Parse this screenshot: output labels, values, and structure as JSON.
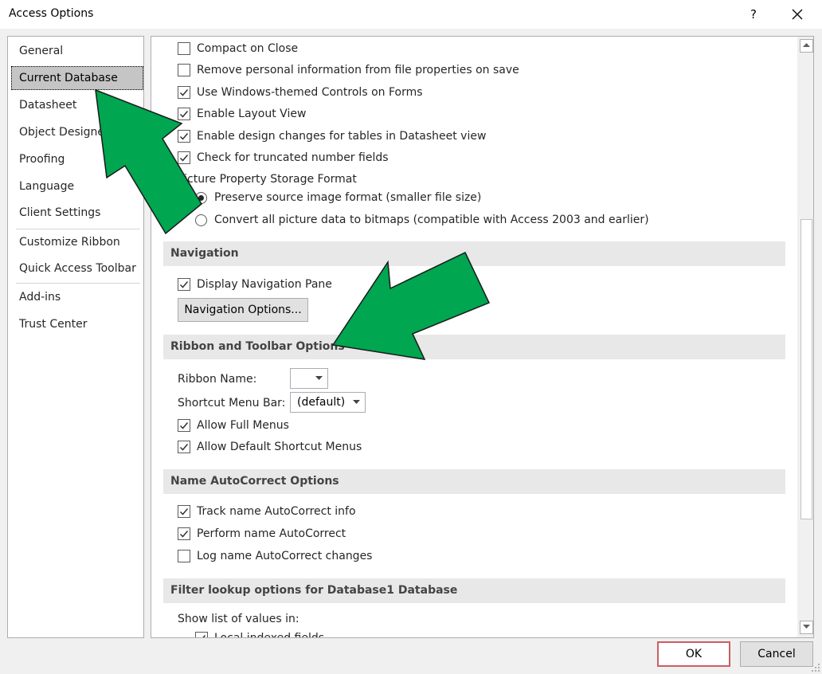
{
  "window": {
    "title": "Access Options",
    "help_label": "?"
  },
  "sidebar": {
    "items": [
      {
        "label": "General"
      },
      {
        "label": "Current Database"
      },
      {
        "label": "Datasheet"
      },
      {
        "label": "Object Designers"
      },
      {
        "label": "Proofing"
      },
      {
        "label": "Language"
      },
      {
        "label": "Client Settings"
      },
      {
        "label": "Customize Ribbon"
      },
      {
        "label": "Quick Access Toolbar"
      },
      {
        "label": "Add-ins"
      },
      {
        "label": "Trust Center"
      }
    ],
    "selected": "Current Database"
  },
  "application_options": {
    "compact_on_close": {
      "label": "Compact on Close",
      "checked": false
    },
    "remove_personal_info": {
      "label": "Remove personal information from file properties on save",
      "checked": false
    },
    "windows_themed_controls": {
      "label": "Use Windows-themed Controls on Forms",
      "checked": true
    },
    "enable_layout_view": {
      "label": "Enable Layout View",
      "checked": true
    },
    "enable_design_changes": {
      "label": "Enable design changes for tables in Datasheet view",
      "checked": true
    },
    "check_truncated": {
      "label": "Check for truncated number fields",
      "checked": true
    },
    "picture_storage_label": "Picture Property Storage Format",
    "preserve_format": {
      "label": "Preserve source image format (smaller file size)",
      "selected": true
    },
    "convert_bitmaps": {
      "label": "Convert all picture data to bitmaps (compatible with Access 2003 and earlier)",
      "selected": false
    }
  },
  "navigation": {
    "heading": "Navigation",
    "display_nav_pane": {
      "label": "Display Navigation Pane",
      "checked": true
    },
    "nav_options_button": "Navigation Options..."
  },
  "ribbon": {
    "heading": "Ribbon and Toolbar Options",
    "ribbon_name_label": "Ribbon Name:",
    "ribbon_name_value": "",
    "shortcut_menu_label": "Shortcut Menu Bar:",
    "shortcut_menu_value": "(default)",
    "allow_full_menus": {
      "label": "Allow Full Menus",
      "checked": true
    },
    "allow_default_shortcut": {
      "label": "Allow Default Shortcut Menus",
      "checked": true
    }
  },
  "autocorrect": {
    "heading": "Name AutoCorrect Options",
    "track_info": {
      "label": "Track name AutoCorrect info",
      "checked": true
    },
    "perform": {
      "label": "Perform name AutoCorrect",
      "checked": true
    },
    "log_changes": {
      "label": "Log name AutoCorrect changes",
      "checked": false
    }
  },
  "filter": {
    "heading": "Filter lookup options for Database1 Database",
    "show_list_label": "Show list of values in:",
    "local_indexed": {
      "label": "Local indexed fields",
      "checked": true
    }
  },
  "footer": {
    "ok_label": "OK",
    "cancel_label": "Cancel"
  },
  "colors": {
    "arrow_fill": "#00a650",
    "ok_border": "#cc5e62",
    "section_bg": "#e8e8e8"
  }
}
